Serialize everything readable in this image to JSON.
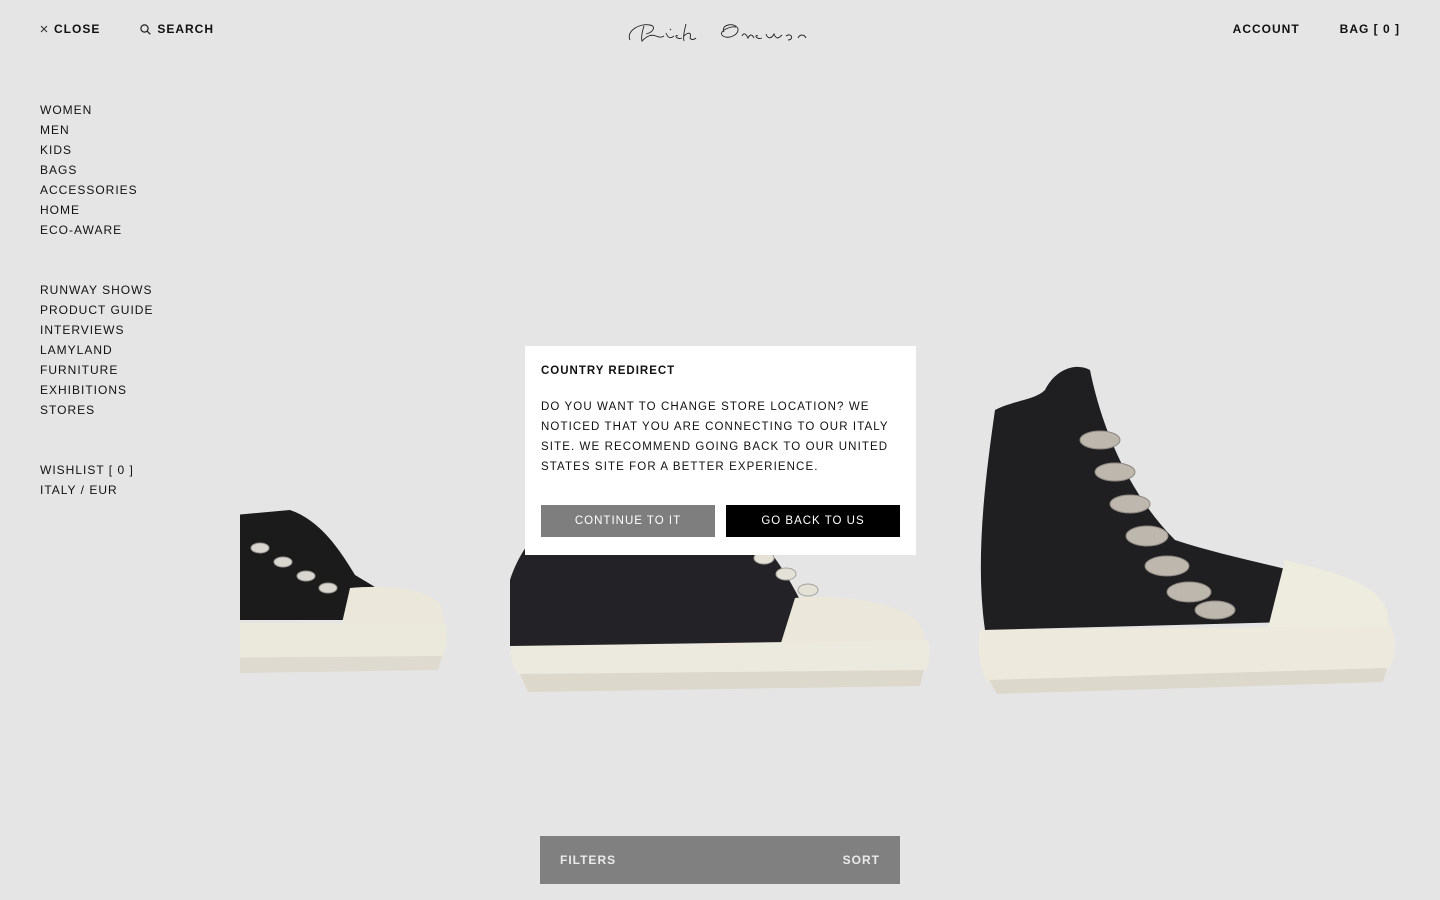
{
  "header": {
    "close_label": "CLOSE",
    "search_label": "SEARCH",
    "logo_text": "Rick Owens",
    "account_label": "ACCOUNT",
    "bag_label": "BAG [ 0 ]"
  },
  "sidebar": {
    "categories": [
      "WOMEN",
      "MEN",
      "KIDS",
      "BAGS",
      "ACCESSORIES",
      "HOME",
      "ECO-AWARE"
    ],
    "editorial": [
      "RUNWAY SHOWS",
      "PRODUCT GUIDE",
      "INTERVIEWS",
      "LAMYLAND",
      "FURNITURE",
      "EXHIBITIONS",
      "STORES"
    ],
    "utility": [
      "WISHLIST [ 0 ]",
      "ITALY / EUR"
    ]
  },
  "modal": {
    "title": "COUNTRY REDIRECT",
    "body": "DO YOU WANT TO CHANGE STORE LOCATION? WE NOTICED THAT YOU ARE CONNECTING TO OUR ITALY SITE. WE RECOMMEND GOING BACK TO OUR UNITED STATES SITE FOR A BETTER EXPERIENCE.",
    "continue_label": "CONTINUE TO IT",
    "goback_label": "GO BACK TO US"
  },
  "filterbar": {
    "filters_label": "FILTERS",
    "sort_label": "SORT"
  },
  "colors": {
    "background": "#e5e5e5",
    "modal_bg": "#ffffff",
    "continue_btn": "#7e7e7e",
    "goback_btn": "#000000",
    "filterbar_bg": "#808080"
  }
}
